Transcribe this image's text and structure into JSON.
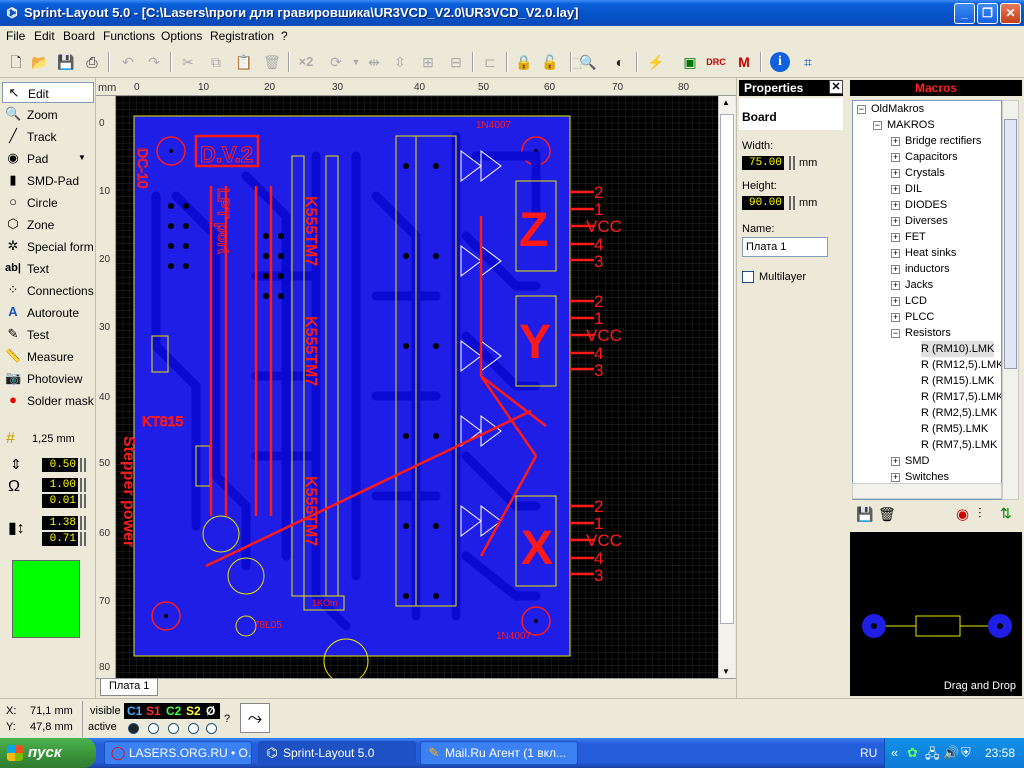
{
  "window": {
    "title": "Sprint-Layout 5.0 - [C:\\Lasers\\проги для гравировшика\\UR3VCD_V2.0\\UR3VCD_V2.0.lay]"
  },
  "menu": [
    "File",
    "Edit",
    "Board",
    "Functions",
    "Options",
    "Registration",
    "?"
  ],
  "toolbar": {
    "x2_label": "×2",
    "icons": [
      "new-file-icon",
      "open-folder-icon",
      "save-icon",
      "print-icon",
      "undo-icon",
      "redo-icon",
      "cut-icon",
      "copy-icon",
      "paste-icon",
      "delete-icon",
      "duplicate-icon",
      "rotate-icon",
      "mirror-h-icon",
      "mirror-v-icon",
      "align-icon",
      "group-icon",
      "lock-icon",
      "unlock-icon",
      "mask-icon",
      "zoom-icon",
      "contrast-icon",
      "autoroute-icon",
      "drc-icon",
      "macro-m-icon",
      "info-icon",
      "crop-icon"
    ]
  },
  "tools": {
    "items": [
      {
        "label": "Edit",
        "icon": "arrow-icon"
      },
      {
        "label": "Zoom",
        "icon": "magnifier-icon"
      },
      {
        "label": "Track",
        "icon": "track-icon"
      },
      {
        "label": "Pad",
        "icon": "pad-icon"
      },
      {
        "label": "SMD-Pad",
        "icon": "smd-pad-icon"
      },
      {
        "label": "Circle",
        "icon": "circle-icon"
      },
      {
        "label": "Zone",
        "icon": "zone-icon"
      },
      {
        "label": "Special form",
        "icon": "special-form-icon"
      },
      {
        "label": "Text",
        "icon": "text-icon"
      },
      {
        "label": "Connections",
        "icon": "connections-icon"
      },
      {
        "label": "Autoroute",
        "icon": "autoroute-icon"
      },
      {
        "label": "Test",
        "icon": "test-icon"
      },
      {
        "label": "Measure",
        "icon": "measure-icon"
      },
      {
        "label": "Photoview",
        "icon": "camera-icon"
      },
      {
        "label": "Solder mask",
        "icon": "solder-mask-icon"
      }
    ],
    "grid_label": "1,25 mm",
    "track_width": "0.50",
    "pad_outer": "1.00",
    "pad_inner": "0.01",
    "smd_w": "1.38",
    "smd_h": "0.71",
    "swatch_color": "#00ff00"
  },
  "ruler": {
    "unit": "mm",
    "top": [
      "0",
      "10",
      "20",
      "30",
      "40",
      "50",
      "60",
      "70",
      "80"
    ],
    "left": [
      "0",
      "10",
      "20",
      "30",
      "40",
      "50",
      "60",
      "70",
      "80"
    ]
  },
  "board_text": {
    "label_dv2": "D.V.2",
    "ic1": "K555TM7",
    "ic2": "K555TM7",
    "ic3": "K555TM7",
    "lpt": "LPT port",
    "stepper": "Stepper power",
    "kt": "KT815",
    "lm": "78L05",
    "lbl_2": "2",
    "lbl_1": "1",
    "lbl_vcc": "VCC",
    "lbl_4": "4",
    "lbl_3": "3",
    "axis_z": "Z",
    "axis_y": "Y",
    "axis_x": "X",
    "in4007_top": "1N4007",
    "in4007_bot": "1N4007",
    "dc10": "DC-10",
    "r1k": "1KOm"
  },
  "tab": {
    "label": "Плата 1"
  },
  "properties": {
    "title": "Properties",
    "section": "Board",
    "width_label": "Width:",
    "width_value": "75.00",
    "height_label": "Height:",
    "height_value": "90.00",
    "unit": "mm",
    "name_label": "Name:",
    "name_value": "Плата 1",
    "multilayer_label": "Multilayer"
  },
  "macros": {
    "title": "Macros",
    "tree": {
      "root": "OldMakros",
      "sub": "MAKROS",
      "items": [
        "Bridge rectifiers",
        "Capacitors",
        "Crystals",
        "DIL",
        "DIODES",
        "Diverses",
        "FET",
        "Heat sinks",
        "inductors",
        "Jacks",
        "LCD",
        "PLCC",
        "Resistors"
      ],
      "resistors": [
        "R (RM10).LMK",
        "R (RM12,5).LMK",
        "R (RM15).LMK",
        "R (RM17,5).LMK",
        "R (RM2,5).LMK",
        "R (RM5).LMK",
        "R (RM7,5).LMK"
      ],
      "after": [
        "SMD",
        "Switches"
      ]
    },
    "drag_hint": "Drag and Drop"
  },
  "status": {
    "x_label": "X:",
    "x_value": "71,1 mm",
    "y_label": "Y:",
    "y_value": "47,8 mm",
    "visible_label": "visible",
    "active_label": "active",
    "layers": [
      {
        "label": "C1",
        "color": "#4aa8ff"
      },
      {
        "label": "S1",
        "color": "#ff3030"
      },
      {
        "label": "C2",
        "color": "#40ff40"
      },
      {
        "label": "S2",
        "color": "#ffff40"
      },
      {
        "label": "Ø",
        "color": "#ffffff"
      }
    ],
    "help": "?"
  },
  "taskbar": {
    "start": "пуск",
    "tasks": [
      {
        "label": "LASERS.ORG.RU • О...",
        "icon": "opera-icon"
      },
      {
        "label": "Sprint-Layout 5.0",
        "icon": "sprint-layout-icon"
      },
      {
        "label": "Mail.Ru Агент (1 вкл...",
        "icon": "mail-agent-icon"
      }
    ],
    "lang": "RU",
    "clock": "23:58"
  },
  "colors": {
    "copper": "#1e1ee6",
    "trace": "#0a0ad0",
    "silk": "#ff1a1a",
    "outline": "#e6e600",
    "hole": "#000000"
  }
}
